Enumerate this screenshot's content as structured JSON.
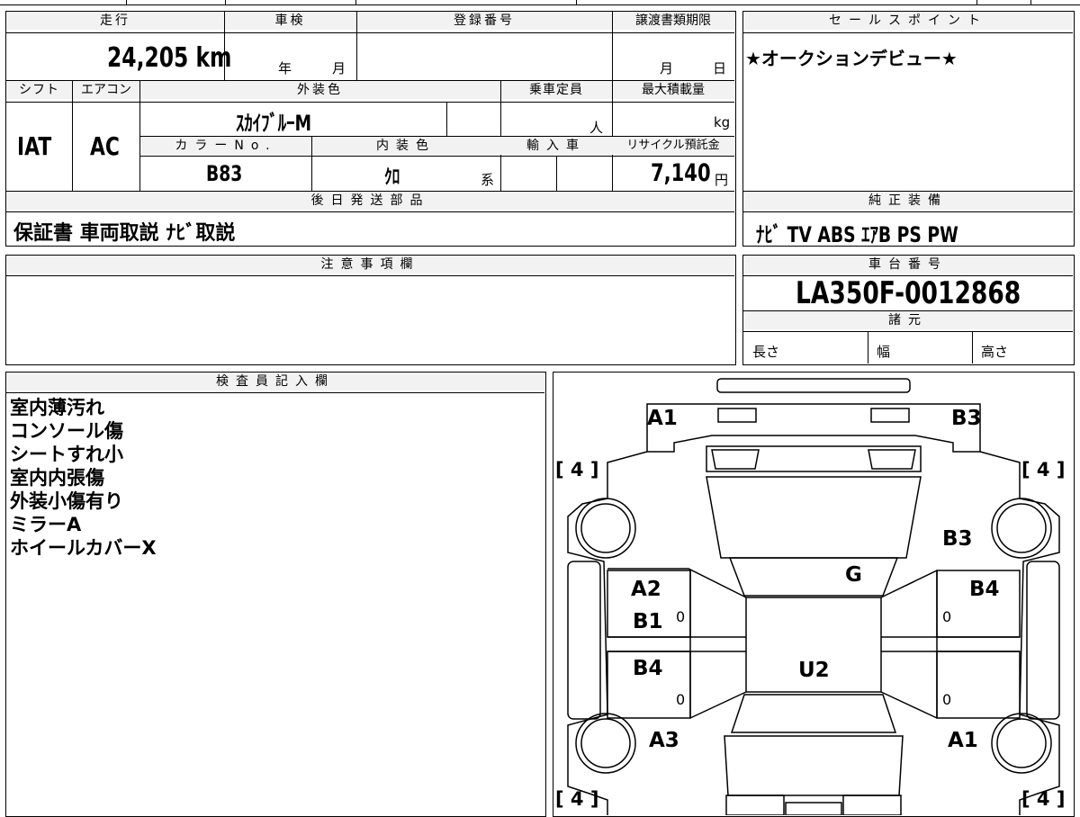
{
  "vehicle_info": {
    "mileage_label": "走行",
    "mileage_value": "24,205 km",
    "inspection_label": "車検",
    "inspection_year_unit": "年",
    "inspection_month_unit": "月",
    "registration_label": "登録番号",
    "registration_value": "",
    "transfer_label": "譲渡書類期限",
    "transfer_month_unit": "月",
    "transfer_day_unit": "日",
    "shift_label": "シフト",
    "shift_value": "IAT",
    "ac_label": "エアコン",
    "ac_value": "AC",
    "exterior_label": "外装色",
    "exterior_value": "ｽｶｲﾌﾞﾙｰM",
    "capacity_label": "乗車定員",
    "capacity_unit": "人",
    "max_load_label": "最大積載量",
    "max_load_unit": "kg",
    "color_no_label": "カラーNo.",
    "color_no_value": "B83",
    "interior_label": "内装色",
    "interior_value": "ｸﾛ",
    "interior_unit": "系",
    "import_label": "輸入車",
    "recycle_label": "リサイクル預託金",
    "recycle_value": "7,140",
    "recycle_unit": "円",
    "later_parts_label": "後日発送部品",
    "later_parts_value": "保証書 車両取説 ﾅﾋﾞ取説"
  },
  "sales_point": {
    "label": "セールスポイント",
    "value": "★オークションデビュー★"
  },
  "equipment": {
    "label": "純正装備",
    "value": "ﾅﾋﾞ TV ABS ｴｱB PS PW"
  },
  "notes": {
    "label": "注意事項欄",
    "value": ""
  },
  "chassis": {
    "label": "車台番号",
    "value": "LA350F-0012868",
    "spec_label": "諸元",
    "length_label": "長さ",
    "width_label": "幅",
    "height_label": "高さ"
  },
  "inspector": {
    "label": "検査員記入欄",
    "lines": [
      "室内薄汚れ",
      "コンソール傷",
      "シートすれ小",
      "室内内張傷",
      "外装小傷有り",
      "ミラーA",
      "ホイールカバーX"
    ]
  },
  "diagram": {
    "marks": {
      "a1_top": "A1",
      "b3_top": "B3",
      "b3_right": "B3",
      "g": "G",
      "a2": "A2",
      "b1": "B1",
      "b4_right": "B4",
      "b4_left": "B4",
      "u2": "U2",
      "a3": "A3",
      "a1_bottom": "A1"
    },
    "tire_tl": "[ 4 ]",
    "tire_tr": "[ 4 ]",
    "tire_bl": "[ 4 ]",
    "tire_br": "[ 4 ]",
    "zero_1": "0",
    "zero_2": "0",
    "zero_3": "0",
    "zero_4": "0"
  }
}
